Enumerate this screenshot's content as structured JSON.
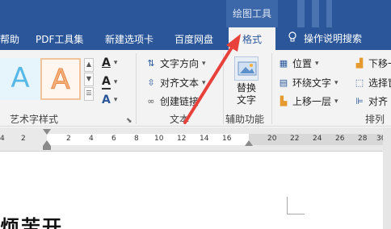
{
  "title_bar": {
    "contextual_tab": "绘图工具"
  },
  "menu_tabs": {
    "help_partial": "帮助",
    "pdf_tools": "PDF工具集",
    "new_tab": "新建选项卡",
    "baidu_netdisk": "百度网盘",
    "format": "格式",
    "tell_me": "操作说明搜索"
  },
  "ribbon": {
    "wordart": {
      "sample_1": "A",
      "sample_2": "A",
      "group_label": "艺术字样式",
      "text_fill": "A",
      "text_outline": "A",
      "text_effects": "A"
    },
    "text_group": {
      "text_direction": "文字方向",
      "align_text": "对齐文本",
      "create_link": "创建链接",
      "group_label": "文本"
    },
    "accessibility": {
      "alt_text_line1": "替换",
      "alt_text_line2": "文字",
      "group_label": "辅助功能"
    },
    "arrange": {
      "position": "位置",
      "wrap_text": "环绕文字",
      "bring_forward": "上移一层",
      "send_backward_partial": "下移一",
      "selection_pane_partial": "选择窗",
      "align_partial": "对齐",
      "group_label": "排列"
    }
  },
  "ruler": {
    "ticks": [
      "4",
      "2",
      "2",
      "4",
      "6",
      "8",
      "10",
      "12",
      "14",
      "16",
      "20",
      "22",
      "24",
      "26",
      "28",
      "30"
    ]
  },
  "document": {
    "heading_partial": "烦苦开"
  },
  "annotation": {
    "color": "#e8403a"
  },
  "colors": {
    "accent": "#2b579a",
    "ribbon_bg": "#f3f3f3"
  }
}
